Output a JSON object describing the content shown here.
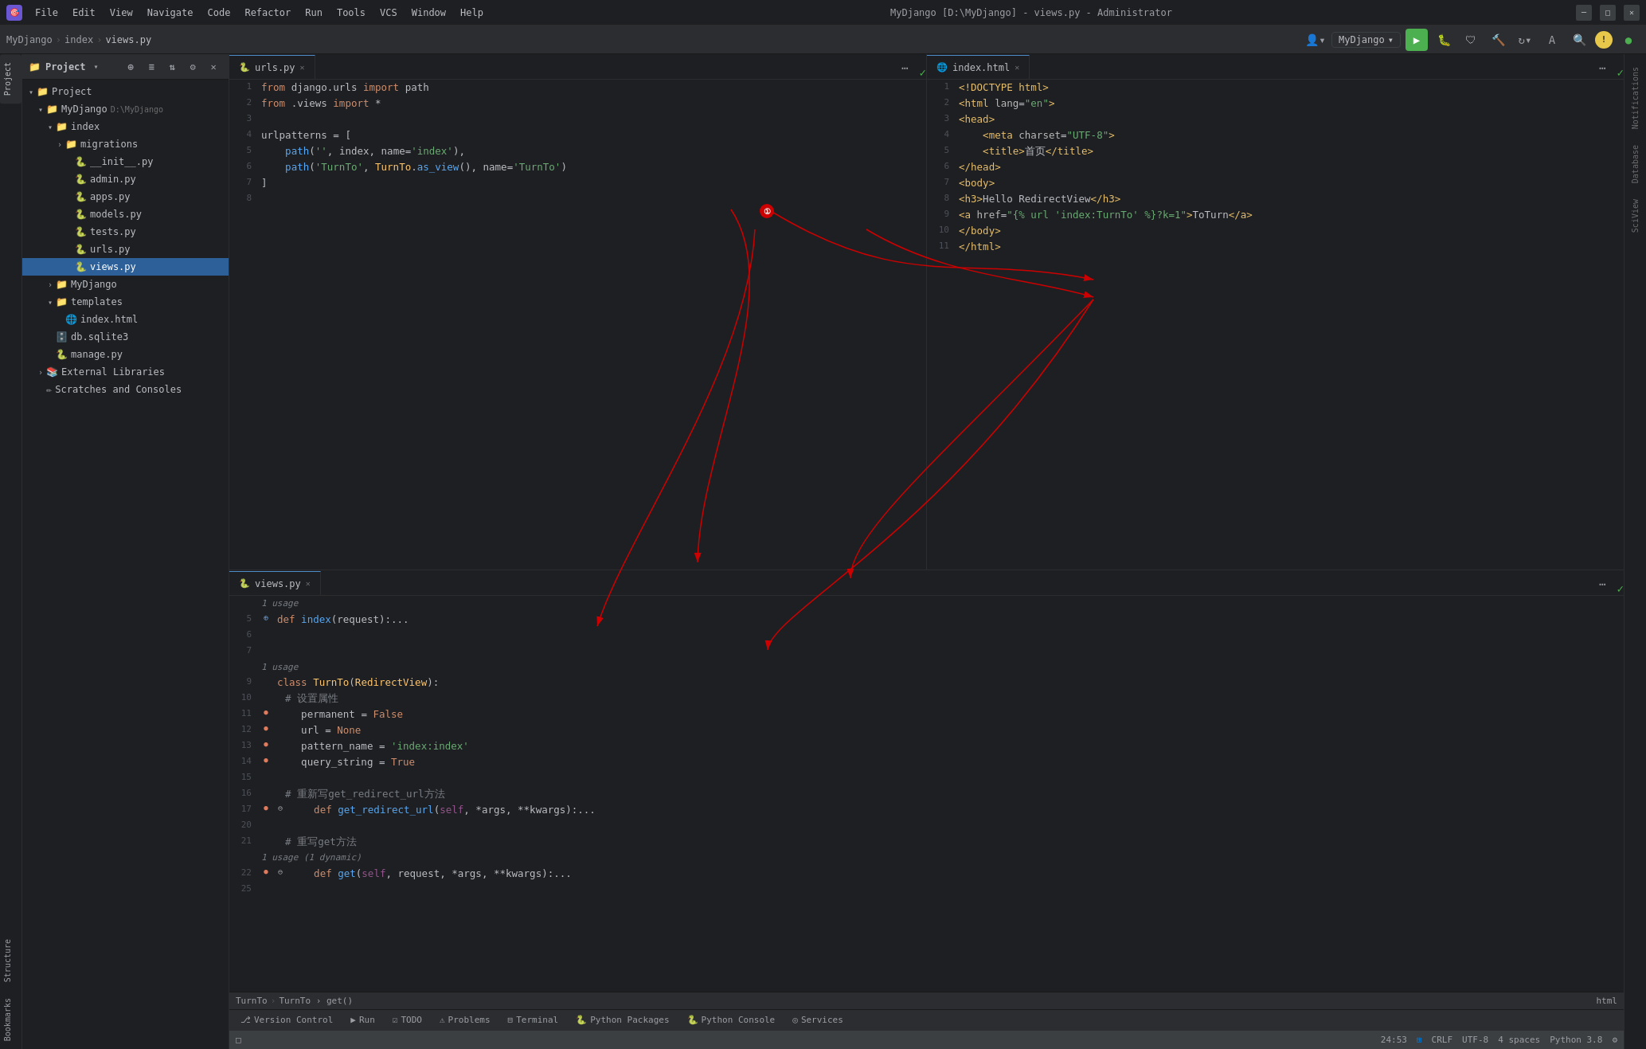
{
  "app": {
    "title": "MyDjango [D:\\MyDjango] - views.py - Administrator",
    "logo": "🎯"
  },
  "title_bar": {
    "menus": [
      "File",
      "Edit",
      "View",
      "Navigate",
      "Code",
      "Refactor",
      "Run",
      "Tools",
      "VCS",
      "Window",
      "Help"
    ],
    "project_name": "MyDjango",
    "breadcrumb": [
      "MyDjango",
      "index",
      "views.py"
    ]
  },
  "nav": {
    "run_config": "MyDjango",
    "breadcrumb": [
      "MyDjango",
      "index",
      "views.py"
    ]
  },
  "project_tree": {
    "header": "Project",
    "items": [
      {
        "id": "project-root",
        "label": "Project",
        "indent": 0,
        "type": "root",
        "icon": "📁",
        "expanded": true
      },
      {
        "id": "mydjango-root",
        "label": "MyDjango",
        "path": "D:\\MyDjango",
        "indent": 1,
        "type": "folder",
        "icon": "📁",
        "expanded": true
      },
      {
        "id": "index-folder",
        "label": "index",
        "indent": 2,
        "type": "folder",
        "icon": "📁",
        "expanded": true
      },
      {
        "id": "migrations-folder",
        "label": "migrations",
        "indent": 3,
        "type": "folder",
        "icon": "📁",
        "expanded": false
      },
      {
        "id": "init-py",
        "label": "__init__.py",
        "indent": 3,
        "type": "python",
        "icon": "🐍"
      },
      {
        "id": "admin-py",
        "label": "admin.py",
        "indent": 3,
        "type": "python",
        "icon": "🐍"
      },
      {
        "id": "apps-py",
        "label": "apps.py",
        "indent": 3,
        "type": "python",
        "icon": "🐍"
      },
      {
        "id": "models-py",
        "label": "models.py",
        "indent": 3,
        "type": "python",
        "icon": "🐍"
      },
      {
        "id": "tests-py",
        "label": "tests.py",
        "indent": 3,
        "type": "python",
        "icon": "🐍"
      },
      {
        "id": "urls-py",
        "label": "urls.py",
        "indent": 3,
        "type": "python",
        "icon": "🐍"
      },
      {
        "id": "views-py",
        "label": "views.py",
        "indent": 3,
        "type": "python",
        "icon": "🐍",
        "selected": true
      },
      {
        "id": "mydjango-folder",
        "label": "MyDjango",
        "indent": 2,
        "type": "folder",
        "icon": "📁",
        "expanded": false
      },
      {
        "id": "templates-folder",
        "label": "templates",
        "indent": 2,
        "type": "folder",
        "icon": "📁",
        "expanded": true
      },
      {
        "id": "index-html",
        "label": "index.html",
        "indent": 3,
        "type": "html",
        "icon": "🌐"
      },
      {
        "id": "db-sqlite",
        "label": "db.sqlite3",
        "indent": 2,
        "type": "db",
        "icon": "🗄️"
      },
      {
        "id": "manage-py",
        "label": "manage.py",
        "indent": 2,
        "type": "python",
        "icon": "🐍"
      },
      {
        "id": "ext-libraries",
        "label": "External Libraries",
        "indent": 1,
        "type": "folder",
        "icon": "📚",
        "expanded": false
      },
      {
        "id": "scratches",
        "label": "Scratches and Consoles",
        "indent": 1,
        "type": "scratches",
        "icon": "✏️"
      }
    ]
  },
  "editors": {
    "urls_tab": {
      "filename": "urls.py",
      "active": true,
      "lines": [
        {
          "num": 1,
          "content": "from django.urls import path"
        },
        {
          "num": 2,
          "content": "from .views import *"
        },
        {
          "num": 3,
          "content": ""
        },
        {
          "num": 4,
          "content": "urlpatterns = ["
        },
        {
          "num": 5,
          "content": "    path('', index, name='index'),"
        },
        {
          "num": 6,
          "content": "    path('TurnTo', TurnTo.as_view(), name='TurnTo')"
        },
        {
          "num": 7,
          "content": "]"
        },
        {
          "num": 8,
          "content": ""
        }
      ]
    },
    "index_tab": {
      "filename": "index.html",
      "active": true,
      "lines": [
        {
          "num": 1,
          "content": "<!DOCTYPE html>"
        },
        {
          "num": 2,
          "content": "<html lang=\"en\">"
        },
        {
          "num": 3,
          "content": "<head>"
        },
        {
          "num": 4,
          "content": "    <meta charset=\"UTF-8\">"
        },
        {
          "num": 5,
          "content": "    <title>首页</title>"
        },
        {
          "num": 6,
          "content": "</head>"
        },
        {
          "num": 7,
          "content": "<body>"
        },
        {
          "num": 8,
          "content": "<h3>Hello RedirectView</h3>"
        },
        {
          "num": 9,
          "content": "<a href=\"{% url 'index:TurnTo' %}?k=1\">ToTurn</a>"
        },
        {
          "num": 10,
          "content": "</body>"
        },
        {
          "num": 11,
          "content": "</html>"
        }
      ]
    },
    "views_tab": {
      "filename": "views.py",
      "active": true,
      "lines": [
        {
          "num": 5,
          "usage": "1 usage",
          "content": "def index(request):..."
        },
        {
          "num": 6,
          "content": ""
        },
        {
          "num": 7,
          "content": ""
        },
        {
          "num": 9,
          "usage": "1 usage",
          "content": "class TurnTo(RedirectView):"
        },
        {
          "num": 10,
          "content": "    # 设置属性"
        },
        {
          "num": 11,
          "content": "    permanent = False"
        },
        {
          "num": 12,
          "content": "    url = None"
        },
        {
          "num": 13,
          "content": "    pattern_name = 'index:index'"
        },
        {
          "num": 14,
          "content": "    query_string = True"
        },
        {
          "num": 15,
          "content": ""
        },
        {
          "num": 16,
          "content": "    # 重新写get_redirect_url方法"
        },
        {
          "num": 17,
          "content": "    def get_redirect_url(self, *args, **kwargs):..."
        },
        {
          "num": 20,
          "content": ""
        },
        {
          "num": 21,
          "content": "    # 重写get方法"
        },
        {
          "num": 22,
          "usage": "1 usage (1 dynamic)",
          "content": "    def get(self, request, *args, **kwargs):..."
        },
        {
          "num": 25,
          "content": ""
        }
      ]
    }
  },
  "bottom_tabs": [
    {
      "label": "Version Control",
      "icon": "⎇"
    },
    {
      "label": "Run",
      "icon": "▶"
    },
    {
      "label": "TODO",
      "icon": "☑"
    },
    {
      "label": "Problems",
      "icon": "⚠"
    },
    {
      "label": "Terminal",
      "icon": "⊟"
    },
    {
      "label": "Python Packages",
      "icon": "🐍"
    },
    {
      "label": "Python Console",
      "icon": "🐍"
    },
    {
      "label": "Services",
      "icon": "◎"
    }
  ],
  "status_bar": {
    "position": "24:53",
    "encoding": "UTF-8",
    "line_sep": "CRLF",
    "indent": "4 spaces",
    "python": "Python 3.8",
    "breadcrumb": "TurnTo › get()",
    "right_breadcrumb": "html"
  },
  "right_panels": {
    "notifications": "Notifications",
    "database": "Database",
    "scview": "SciView"
  },
  "left_panels": {
    "project": "Project",
    "structure": "Structure",
    "bookmarks": "Bookmarks"
  }
}
